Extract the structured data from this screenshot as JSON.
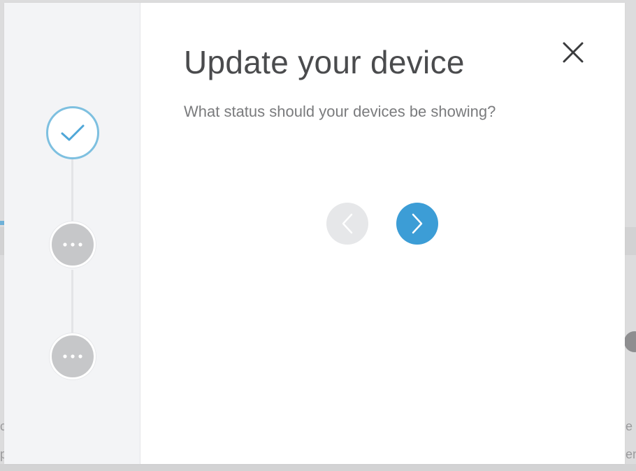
{
  "modal": {
    "title": "Update your device",
    "subtitle": "What status should your devices be showing?",
    "close_icon": "close-icon"
  },
  "stepper": {
    "steps": [
      {
        "status": "complete",
        "icon": "check-icon"
      },
      {
        "status": "pending",
        "icon": "more-dots-icon"
      },
      {
        "status": "pending",
        "icon": "more-dots-icon"
      }
    ]
  },
  "navigation": {
    "previous": {
      "icon": "chevron-left-icon",
      "enabled": false
    },
    "next": {
      "icon": "chevron-right-icon",
      "enabled": true
    }
  },
  "background": {
    "left_fragments": [
      "c",
      "p"
    ],
    "right_fragments": [
      "e",
      "en"
    ],
    "help_icon": "help-icon"
  },
  "colors": {
    "accent": "#3c9dd6",
    "step_complete_border": "#7ec0e0",
    "step_pending": "#c6c7c9",
    "disabled_button": "#e6e7e9"
  }
}
